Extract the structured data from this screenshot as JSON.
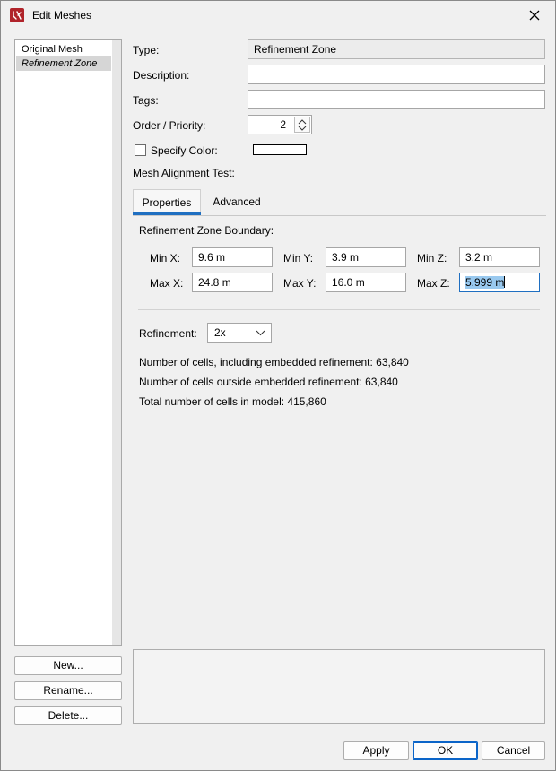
{
  "window": {
    "title": "Edit Meshes",
    "accent": "#1f6fc1",
    "app_icon_color": "#b0232a",
    "icons": {
      "app": "pyrosim-app-icon",
      "close": "close-icon"
    }
  },
  "mesh_list": {
    "items": [
      {
        "label": "Original Mesh",
        "selected": false
      },
      {
        "label": "Refinement Zone",
        "selected": true
      }
    ]
  },
  "left_buttons": {
    "new": "New...",
    "rename": "Rename...",
    "delete": "Delete..."
  },
  "form": {
    "type_label": "Type:",
    "type_value": "Refinement Zone",
    "description_label": "Description:",
    "description_value": "",
    "tags_label": "Tags:",
    "tags_value": "",
    "order_label": "Order / Priority:",
    "order_value": "2",
    "specify_color_label": "Specify Color:",
    "specify_color_checked": false,
    "color_value": "#ffffff",
    "alignment_label": "Mesh Alignment Test:"
  },
  "tabs": [
    {
      "label": "Properties",
      "active": true
    },
    {
      "label": "Advanced",
      "active": false
    }
  ],
  "properties": {
    "boundary_label": "Refinement Zone Boundary:",
    "min_x_label": "Min X:",
    "min_x": "9.6 m",
    "min_y_label": "Min Y:",
    "min_y": "3.9 m",
    "min_z_label": "Min Z:",
    "min_z": "3.2 m",
    "max_x_label": "Max X:",
    "max_x": "24.8 m",
    "max_y_label": "Max Y:",
    "max_y": "16.0 m",
    "max_z_label": "Max Z:",
    "max_z": "5.999 m",
    "refinement_label": "Refinement:",
    "refinement_value": "2x",
    "cells_including": "Number of cells, including embedded refinement: 63,840",
    "cells_outside": "Number of cells outside embedded refinement: 63,840",
    "cells_total": "Total number of cells in model: 415,860"
  },
  "dialog_buttons": {
    "apply": "Apply",
    "ok": "OK",
    "cancel": "Cancel"
  }
}
